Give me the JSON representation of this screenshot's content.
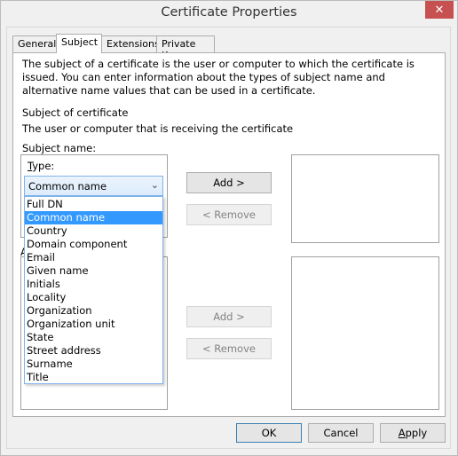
{
  "window": {
    "title": "Certificate Properties",
    "close_icon": "close-icon"
  },
  "tabs": [
    {
      "label": "General",
      "active": false
    },
    {
      "label": "Subject",
      "active": true
    },
    {
      "label": "Extensions",
      "active": false
    },
    {
      "label": "Private Key",
      "active": false
    }
  ],
  "subject_tab": {
    "description": "The subject of a certificate is the user or computer to which the certificate is issued. You can enter information about the types of subject name and alternative name values that can be used in a certificate.",
    "section_title": "Subject of certificate",
    "section_subtitle": "The user or computer that is receiving the certificate",
    "subject_name_label": "Subject name:",
    "type_label_accel": "T",
    "type_label_rest": "ype:",
    "type_select": {
      "selected": "Common name",
      "options": [
        "Full DN",
        "Common name",
        "Country",
        "Domain component",
        "Email",
        "Given name",
        "Initials",
        "Locality",
        "Organization",
        "Organization unit",
        "State",
        "Street address",
        "Surname",
        "Title"
      ],
      "highlighted_index": 1,
      "chevron_icon": "chevron-down-icon"
    },
    "alternative_name_label_visible_char": "A",
    "subject_buttons": {
      "add": "Add >",
      "remove": "< Remove"
    },
    "alt_buttons": {
      "add": "Add >",
      "remove": "< Remove"
    }
  },
  "footer": {
    "ok": "OK",
    "cancel": "Cancel",
    "apply_accel": "A",
    "apply_rest": "pply"
  }
}
